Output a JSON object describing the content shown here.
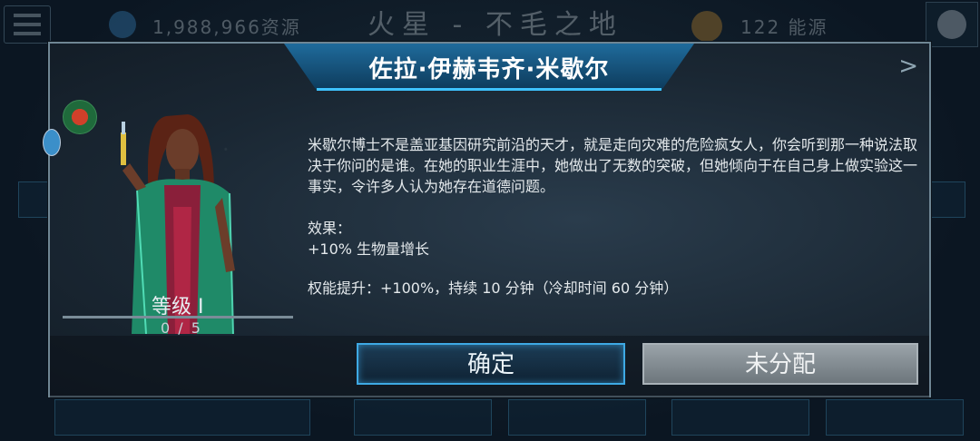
{
  "background": {
    "resources_text": "1,988,966资源",
    "location_title": "火星 - 不毛之地",
    "energy_text": "122 能源"
  },
  "modal": {
    "title": "佐拉·伊赫韦齐·米歇尔",
    "next_arrow": ">",
    "level_label": "等级 I",
    "level_count": "0 / 5",
    "level_progress": 0,
    "description": "米歇尔博士不是盖亚基因研究前沿的天才，就是走向灾难的危险疯女人，你会听到那一种说法取决于你问的是谁。在她的职业生涯中，她做出了无数的突破，但她倾向于在自己身上做实验这一事实，令许多人认为她存在道德问题。",
    "effect_label": "效果：",
    "effect_value": "+10% 生物量增长",
    "boost_text": "权能提升：+100%，持续 10 分钟（冷却时间 60 分钟）",
    "confirm_button": "确定",
    "unassign_button": "未分配"
  },
  "colors": {
    "accent": "#3ea9e4",
    "header": "#1f6b9c"
  }
}
